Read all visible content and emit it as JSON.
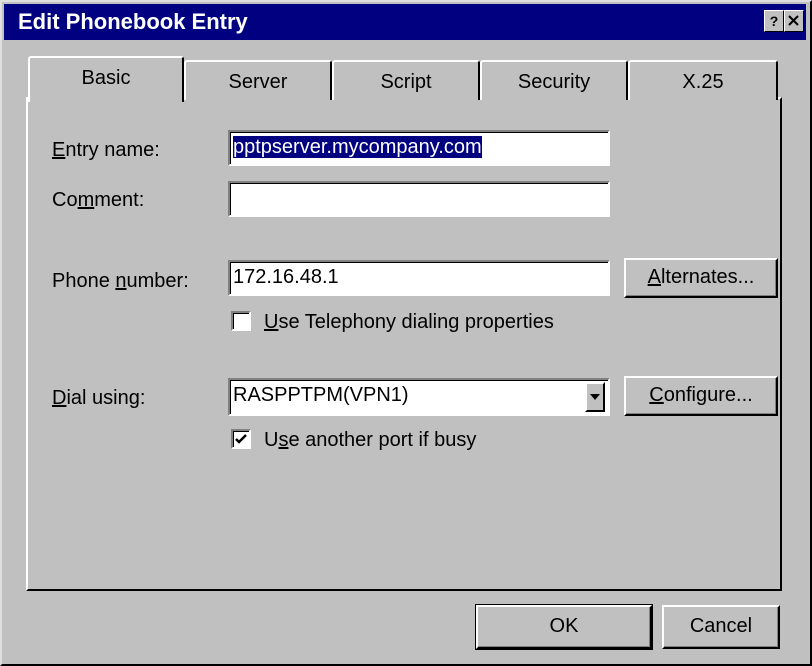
{
  "window": {
    "title": "Edit Phonebook Entry",
    "help_glyph": "?"
  },
  "tabs": [
    {
      "label": "Basic",
      "selected": true
    },
    {
      "label": "Server",
      "selected": false
    },
    {
      "label": "Script",
      "selected": false
    },
    {
      "label": "Security",
      "selected": false
    },
    {
      "label": "X.25",
      "selected": false
    }
  ],
  "form": {
    "entry_name": {
      "label_pre": "",
      "label_ul": "E",
      "label_post": "ntry name:",
      "value": "pptpserver.mycompany.com"
    },
    "comment": {
      "label_pre": "Co",
      "label_ul": "m",
      "label_post": "ment:",
      "value": ""
    },
    "phone_number": {
      "label_pre": "Phone ",
      "label_ul": "n",
      "label_post": "umber:",
      "value": "172.16.48.1"
    },
    "alternates_button": {
      "pre": "",
      "ul": "A",
      "post": "lternates..."
    },
    "telephony_checkbox": {
      "pre": "",
      "ul": "U",
      "post": "se Telephony dialing properties",
      "checked": false
    },
    "dial_using": {
      "label_pre": "",
      "label_ul": "D",
      "label_post": "ial using:",
      "value": "RASPPTPM(VPN1)"
    },
    "configure_button": {
      "pre": "",
      "ul": "C",
      "post": "onfigure..."
    },
    "another_port_checkbox": {
      "pre": "U",
      "ul": "s",
      "post": "e another port if busy",
      "checked": true
    }
  },
  "buttons": {
    "ok": "OK",
    "cancel": "Cancel"
  }
}
